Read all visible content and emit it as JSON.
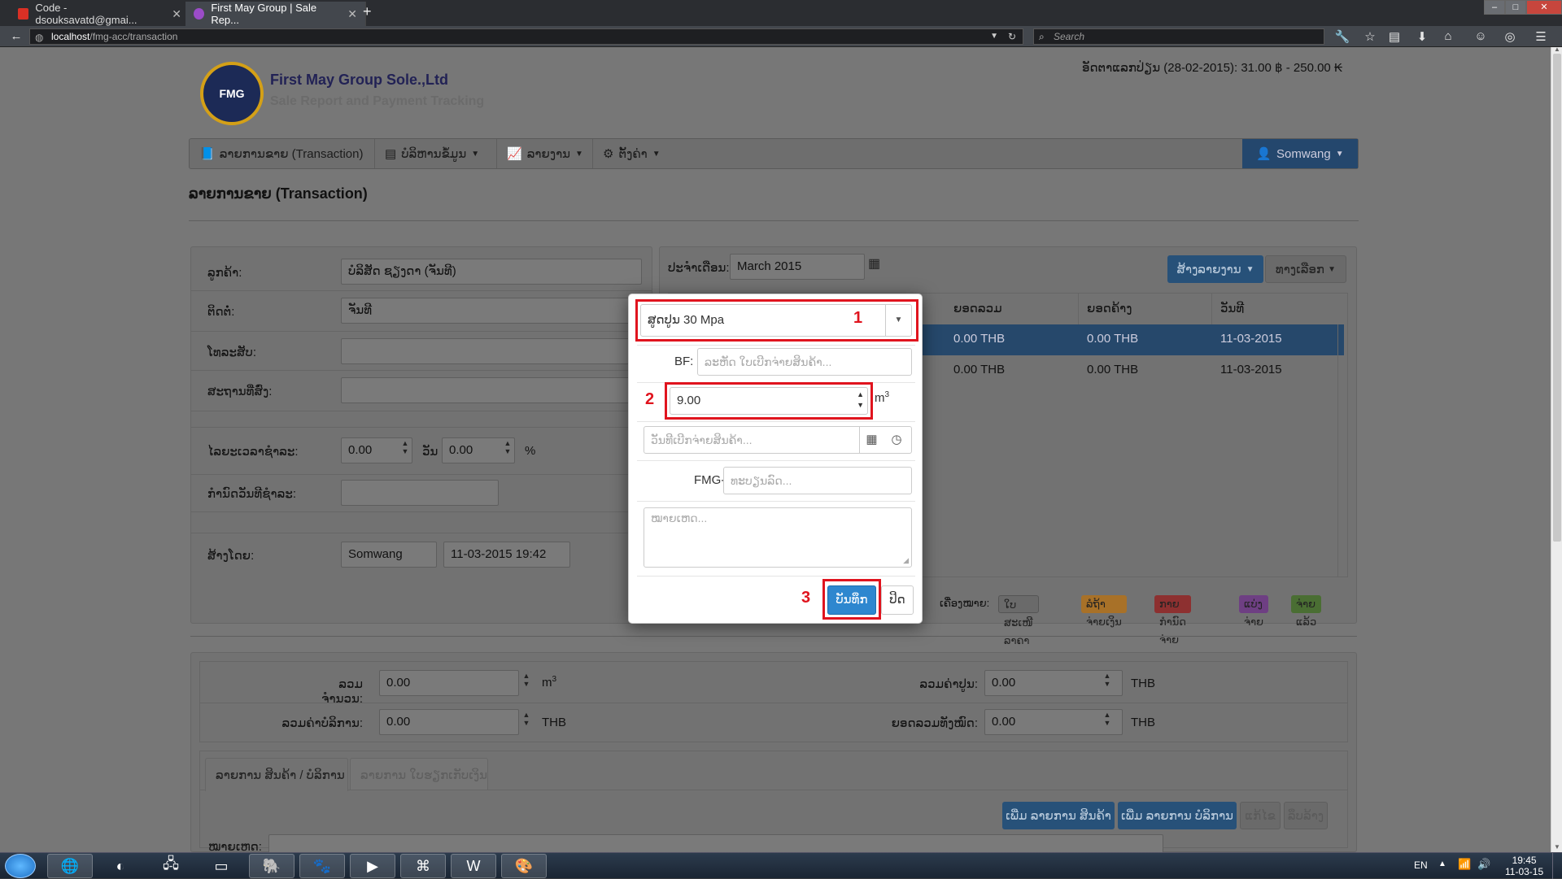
{
  "browser": {
    "tabs": [
      {
        "label": "Code - dsouksavatd@gmai...",
        "active": false
      },
      {
        "label": "First May Group | Sale Rep...",
        "active": true
      }
    ],
    "new_tab": "+",
    "url_host": "localhost",
    "url_path": "/fmg-acc/transaction",
    "search_placeholder": "Search"
  },
  "header": {
    "logo_text": "FMG",
    "company": "First May Group Sole.,Ltd",
    "tagline": "Sale Report and Payment Tracking",
    "exchange_rate": "ອັດຕາແລກປ່ຽນ (28-02-2015): 31.00 ฿ - 250.00 ₭"
  },
  "menu": {
    "items": [
      "ລາຍການຂາຍ (Transaction)",
      "ບໍລິຫານຂໍ້ມູນ",
      "ລາຍງານ",
      "ຕັ້ງຄ່າ"
    ],
    "user": "Somwang"
  },
  "page_title": "ລາຍການຂາຍ (Transaction)",
  "customer_form": {
    "customer_label": "ລູກຄ້າ:",
    "customer_value": "ບໍລິສັດ ຊຽງດາ (ຈັນທີ)",
    "contact_label": "ຕິດຕໍ່:",
    "contact_value": "ຈັນທີ",
    "phone_label": "ໂທລະສັບ:",
    "site_label": "ສະຖານທີ່ສົ່ງ:",
    "discount_label": "ໄລຍະເວລາຊຳລະ:",
    "discount_value": "0.00",
    "day_label": "ວັນ",
    "rate_value": "0.00",
    "percent": "%",
    "due_label": "ກຳນົດວັນທີຊຳລະ:",
    "created_label": "ສ້າງໂດຍ:",
    "created_by": "Somwang",
    "created_at": "11-03-2015 19:42"
  },
  "list_panel": {
    "period_label": "ປະຈຳເດືອນ:",
    "period_value": "March 2015",
    "report_btn": "ສ້າງລາຍງານ",
    "options_btn": "ທາງເລືອກ",
    "columns": [
      "ຍອດລວມ",
      "ຍອດຄ້າງ",
      "ວັນທີ"
    ],
    "rows": [
      {
        "total": "0.00 THB",
        "due": "0.00 THB",
        "date": "11-03-2015"
      },
      {
        "total": "0.00 THB",
        "due": "0.00 THB",
        "date": "11-03-2015"
      }
    ],
    "legend_label": "ເຄື່ອງໝາຍ:",
    "legend": [
      {
        "label": "ໃບສະເໜີລາຄາ",
        "color": "#6a6a6a"
      },
      {
        "label": "ລໍຖ້າຈ່າຍເງິນ",
        "color": "#a87128"
      },
      {
        "label": "ກາຍກຳນົດຈ່າຍ",
        "color": "#8d3030"
      },
      {
        "label": "ແບ່ງຈ່າຍ",
        "color": "#6e3f83"
      },
      {
        "label": "ຈ່າຍແລ້ວ",
        "color": "#4a6e33"
      }
    ]
  },
  "totals": {
    "qty_label": "ລວມຈຳນວນ:",
    "qty_value": "0.00",
    "qty_unit": "m",
    "qty_unit_sup": "3",
    "concrete_label": "ລວມຄ່າປູນ:",
    "concrete_value": "0.00",
    "concrete_unit": "THB",
    "service_label": "ລວມຄ່າບໍລິການ:",
    "service_value": "0.00",
    "service_unit": "THB",
    "grand_label": "ຍອດລວມທັງໝົດ:",
    "grand_value": "0.00",
    "grand_unit": "THB"
  },
  "tabs": {
    "tab1": "ລາຍການ ສິນຄ້າ / ບໍລິການ",
    "tab2": "ລາຍການ ໃບຮຽກເກັບເງິນ",
    "add_product": "ເພີ່ມ ລາຍການ ສິນຄ້າ",
    "add_service": "ເພີ່ມ ລາຍການ ບໍລິການ",
    "edit": "ແກ້ໄຂ",
    "delete": "ລຶບລ້າງ",
    "note_label": "ໝາຍເຫດ:"
  },
  "modal": {
    "product_value": "ສູດປູນ 30 Mpa",
    "bf_label": "BF:",
    "bf_placeholder": "ລະຫັດ ໃບເບີກຈ່າຍສິນຄ້າ...",
    "qty_value": "9.00",
    "qty_unit": "m",
    "qty_unit_sup": "3",
    "date_placeholder": "ວັນທີເບີກຈ່າຍສິນຄ້າ...",
    "fmg_label": "FMG-",
    "fmg_placeholder": "ທະບຽນລົດ...",
    "note_placeholder": "ໝາຍເຫດ...",
    "save_btn": "ບັນທຶກ",
    "close_btn": "ປິດ",
    "annotations": [
      "1",
      "2",
      "3"
    ]
  },
  "taskbar": {
    "lang": "EN",
    "time": "19:45",
    "date": "11-03-15"
  }
}
